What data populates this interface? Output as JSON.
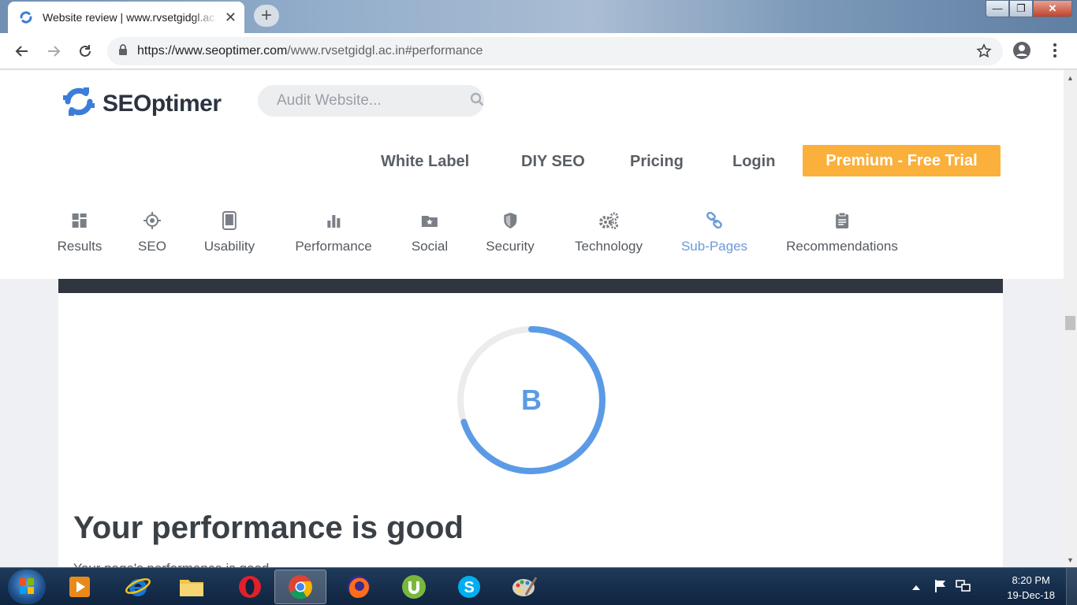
{
  "browser": {
    "tab_title": "Website review | www.rvsetgidgl.ac.in",
    "tab_close": "✕",
    "new_tab": "+",
    "url_host": "https://www.seoptimer.com",
    "url_path": "/www.rvsetgidgl.ac.in#performance",
    "win_min": "—",
    "win_max": "❐",
    "win_close": "✕"
  },
  "site": {
    "logo_text": "SEOptimer",
    "search_placeholder": "Audit Website...",
    "nav": [
      "White Label",
      "DIY SEO",
      "Pricing",
      "Login"
    ],
    "premium_label": "Premium - Free Trial",
    "accent_color": "#fbb03b",
    "link_color": "#6b9ad8"
  },
  "tabs": [
    {
      "label": "Results",
      "icon": "grid-icon"
    },
    {
      "label": "SEO",
      "icon": "target-icon"
    },
    {
      "label": "Usability",
      "icon": "tablet-icon"
    },
    {
      "label": "Performance",
      "icon": "bar-chart-icon"
    },
    {
      "label": "Social",
      "icon": "folder-star-icon"
    },
    {
      "label": "Security",
      "icon": "shield-icon"
    },
    {
      "label": "Technology",
      "icon": "gears-icon"
    },
    {
      "label": "Sub-Pages",
      "icon": "link-icon",
      "active": true
    },
    {
      "label": "Recommendations",
      "icon": "clipboard-icon"
    }
  ],
  "performance": {
    "grade": "B",
    "score_fraction": 0.7,
    "headline": "Your performance is good",
    "paragraph": "Your page's performance is good..."
  },
  "taskbar": {
    "time": "8:20 PM",
    "date": "19-Dec-18",
    "apps": [
      "media-player-icon",
      "internet-explorer-icon",
      "file-explorer-icon",
      "opera-icon",
      "chrome-icon",
      "firefox-icon",
      "utorrent-icon",
      "skype-icon",
      "paint-icon"
    ]
  }
}
